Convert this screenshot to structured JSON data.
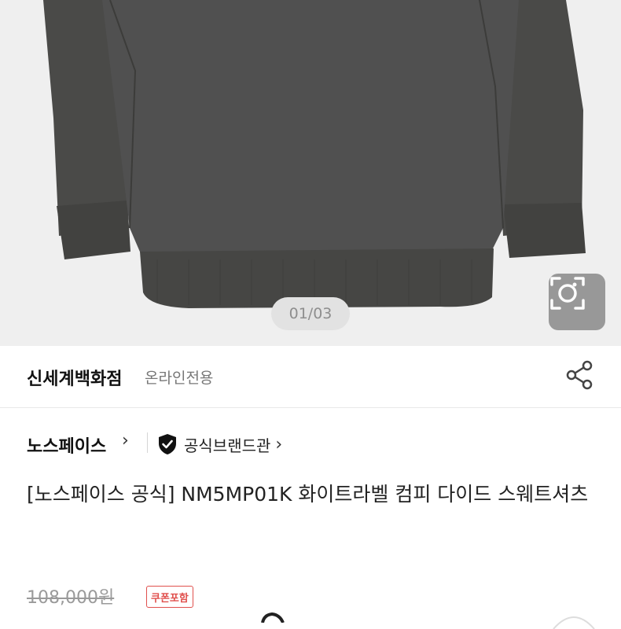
{
  "gallery": {
    "pager": "01/03",
    "lens_icon": "camera-lens-icon"
  },
  "store": {
    "name": "신세계백화점",
    "tag": "온라인전용",
    "share_icon": "share-icon"
  },
  "brand": {
    "name": "노스페이스",
    "official_label": "공식브랜드관",
    "badge_icon": "shield-check-icon"
  },
  "product": {
    "title": "[노스페이스 공식] NM5MP01K 화이트라벨 컴피 다이드 스웨트셔츠"
  },
  "price": {
    "original": "108,000원",
    "coupon_badge": "쿠폰포함",
    "coupon_color": "#e0504d"
  }
}
